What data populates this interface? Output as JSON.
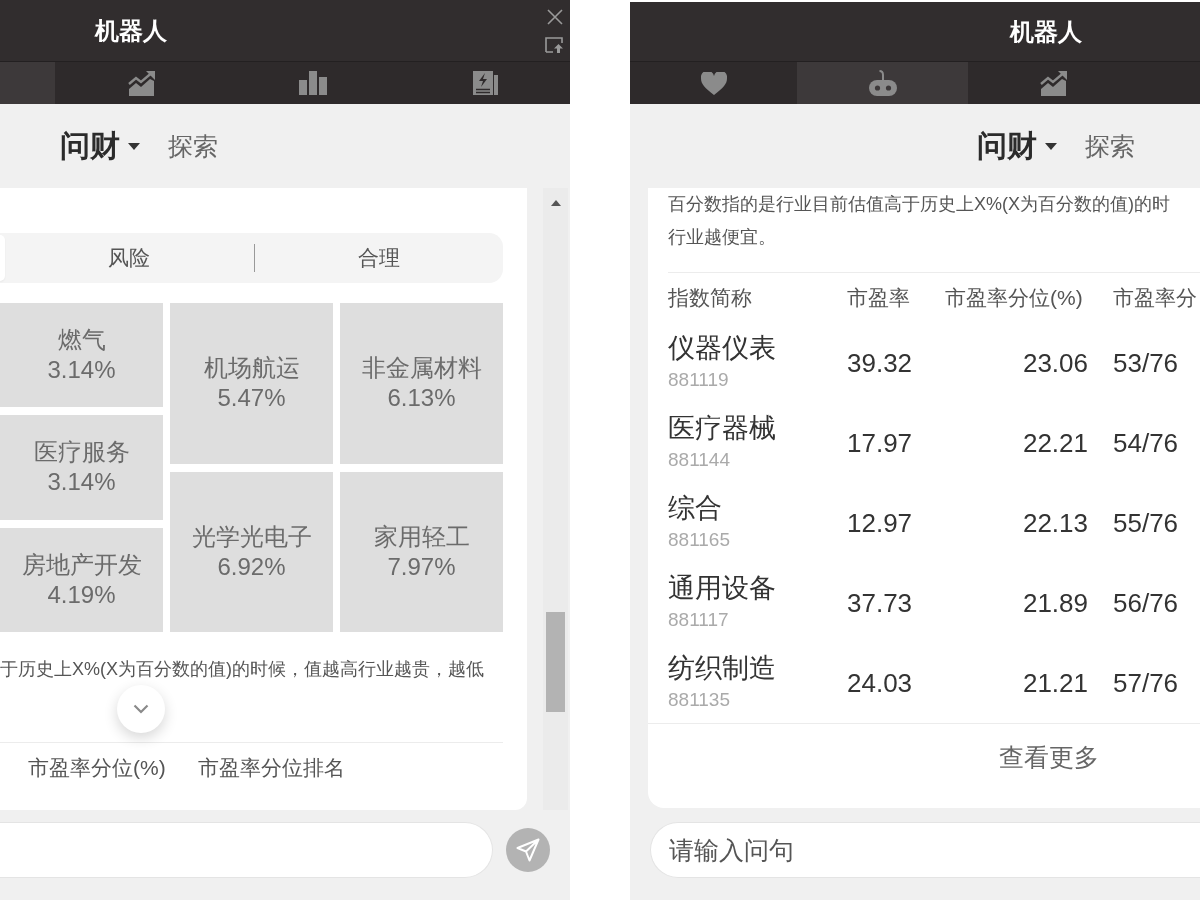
{
  "panels": [
    {
      "kind": "cut-left",
      "title": "机器人",
      "tabs": [
        {
          "selected": true
        },
        {
          "kind": "trend",
          "selected": false
        },
        {
          "kind": "bars",
          "selected": false
        },
        {
          "kind": "news",
          "selected": false
        }
      ],
      "brand": "问财",
      "explore": "探索",
      "segments": [
        {
          "selected": true
        },
        {
          "label": "风险",
          "selected": false
        },
        {
          "label": "合理",
          "selected": false
        }
      ],
      "treemap": {
        "columns": [
          {
            "tiles": [
              {
                "name": "燃气",
                "value": "3.14%"
              },
              {
                "name": "医疗服务",
                "value": "3.14%"
              },
              {
                "name": "房地产开发",
                "value": "4.19%"
              }
            ]
          },
          {
            "tiles": [
              {
                "name": "机场航运",
                "value": "5.47%"
              },
              {
                "name": "光学光电子",
                "value": "6.92%"
              }
            ]
          },
          {
            "tiles": [
              {
                "name": "非金属材料",
                "value": "6.13%"
              },
              {
                "name": "家用轻工",
                "value": "7.97%"
              }
            ]
          }
        ]
      },
      "note_lines": [
        "于历史上X%(X为百分数的值)的时候，值越高行业越贵，越低"
      ],
      "table": {
        "columns": [
          "市盈率分位(%)",
          "市盈率分位排名"
        ]
      }
    },
    {
      "kind": "cut-right",
      "title": "机器人",
      "tabs": [
        {
          "kind": "heart",
          "selected": false
        },
        {
          "kind": "robot",
          "selected": true
        },
        {
          "kind": "trend",
          "selected": false
        }
      ],
      "brand": "问财",
      "explore": "探索",
      "note_lines": [
        "百分数指的是行业目前估值高于历史上X%(X为百分数的值)的时",
        "行业越便宜。"
      ],
      "table": {
        "columns": [
          "指数简称",
          "市盈率",
          "市盈率分位(%)",
          "市盈率分"
        ],
        "rows": [
          {
            "name": "仪器仪表",
            "code": "881119",
            "values": [
              "39.32",
              "23.06",
              "53/76"
            ]
          },
          {
            "name": "医疗器械",
            "code": "881144",
            "values": [
              "17.97",
              "22.21",
              "54/76"
            ]
          },
          {
            "name": "综合",
            "code": "881165",
            "values": [
              "12.97",
              "22.13",
              "55/76"
            ]
          },
          {
            "name": "通用设备",
            "code": "881117",
            "values": [
              "37.73",
              "21.89",
              "56/76"
            ]
          },
          {
            "name": "纺织制造",
            "code": "881135",
            "values": [
              "24.03",
              "21.21",
              "57/76"
            ]
          }
        ]
      },
      "more": "查看更多",
      "input": {
        "placeholder": "请输入问句"
      }
    }
  ]
}
